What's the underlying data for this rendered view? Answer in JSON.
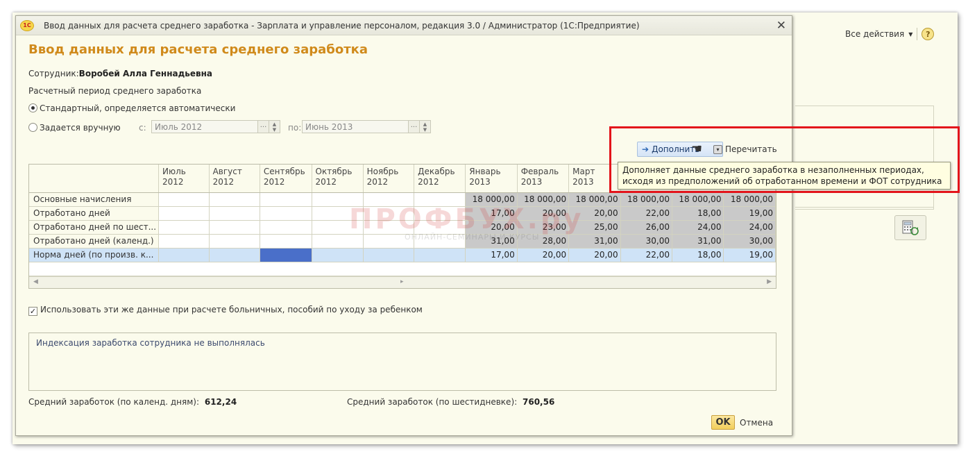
{
  "dialog": {
    "window_title": "Ввод данных для расчета среднего заработка - Зарплата и управление персоналом, редакция 3.0 / Администратор  (1С:Предприятие)",
    "logo_text": "1С",
    "heading": "Ввод данных для расчета среднего заработка",
    "employee_label": "Сотрудник:",
    "employee_name": "Воробей Алла Геннадьевна",
    "period_label": "Расчетный период среднего заработка",
    "radio_standard": "Стандартный, определяется автоматически",
    "radio_manual": "Задается вручную",
    "from_label": "с:",
    "from_value": "Июль 2012",
    "to_label": "по:",
    "to_value": "Июнь 2013",
    "btn_fill": "Дополнить",
    "btn_recount": "Перечитать",
    "tooltip": "Дополняет данные среднего заработка в незаполненных периодах, исходя из предположений об отработанном времени и ФОТ сотрудника",
    "checkbox_label": "Использовать эти же данные при расчете больничных, пособий по уходу за ребенком",
    "indexation_text": "Индексация заработка сотрудника не выполнялась",
    "avg_calendar_label": "Средний заработок (по календ. дням):",
    "avg_calendar_value": "612,24",
    "avg_six_label": "Средний заработок (по шестидневке):",
    "avg_six_value": "760,56",
    "ok_label": "OK",
    "cancel_label": "Отмена"
  },
  "grid": {
    "columns": [
      {
        "m": "Июль",
        "y": "2012"
      },
      {
        "m": "Август",
        "y": "2012"
      },
      {
        "m": "Сентябрь",
        "y": "2012"
      },
      {
        "m": "Октябрь",
        "y": "2012"
      },
      {
        "m": "Ноябрь",
        "y": "2012"
      },
      {
        "m": "Декабрь",
        "y": "2012"
      },
      {
        "m": "Январь",
        "y": "2013"
      },
      {
        "m": "Февраль",
        "y": "2013"
      },
      {
        "m": "Март",
        "y": "2013"
      },
      {
        "m": "",
        "y": ""
      },
      {
        "m": "",
        "y": ""
      },
      {
        "m": "",
        "y": ""
      }
    ],
    "rows": [
      {
        "label": "Основные начисления",
        "values": [
          "",
          "",
          "",
          "",
          "",
          "",
          "18 000,00",
          "18 000,00",
          "18 000,00",
          "18 000,00",
          "18 000,00",
          "18 000,00"
        ]
      },
      {
        "label": "Отработано дней",
        "values": [
          "",
          "",
          "",
          "",
          "",
          "",
          "17,00",
          "20,00",
          "20,00",
          "22,00",
          "18,00",
          "19,00"
        ]
      },
      {
        "label": "Отработано дней по шест...",
        "values": [
          "",
          "",
          "",
          "",
          "",
          "",
          "20,00",
          "23,00",
          "25,00",
          "26,00",
          "24,00",
          "24,00"
        ]
      },
      {
        "label": "Отработано дней (календ.)",
        "values": [
          "",
          "",
          "",
          "",
          "",
          "",
          "31,00",
          "28,00",
          "31,00",
          "30,00",
          "31,00",
          "30,00"
        ]
      },
      {
        "label": "Норма дней (по произв. к...",
        "values": [
          "",
          "",
          "",
          "",
          "",
          "",
          "17,00",
          "20,00",
          "20,00",
          "22,00",
          "18,00",
          "19,00"
        ]
      }
    ]
  },
  "right_panel": {
    "all_actions": "Все действия",
    "help": "?"
  },
  "watermark": {
    "main": "ПРОФБУХ.ру",
    "sub": "ОНЛАЙН-СЕМИНАРЫ И КУРСЫ"
  }
}
